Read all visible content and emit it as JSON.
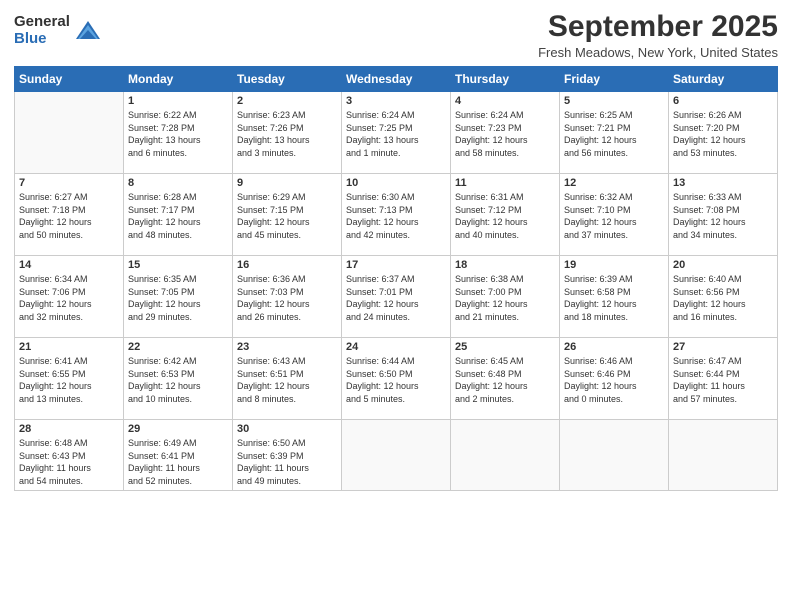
{
  "logo": {
    "general": "General",
    "blue": "Blue"
  },
  "header": {
    "month": "September 2025",
    "location": "Fresh Meadows, New York, United States"
  },
  "days_of_week": [
    "Sunday",
    "Monday",
    "Tuesday",
    "Wednesday",
    "Thursday",
    "Friday",
    "Saturday"
  ],
  "weeks": [
    [
      {
        "day": "",
        "info": ""
      },
      {
        "day": "1",
        "info": "Sunrise: 6:22 AM\nSunset: 7:28 PM\nDaylight: 13 hours\nand 6 minutes."
      },
      {
        "day": "2",
        "info": "Sunrise: 6:23 AM\nSunset: 7:26 PM\nDaylight: 13 hours\nand 3 minutes."
      },
      {
        "day": "3",
        "info": "Sunrise: 6:24 AM\nSunset: 7:25 PM\nDaylight: 13 hours\nand 1 minute."
      },
      {
        "day": "4",
        "info": "Sunrise: 6:24 AM\nSunset: 7:23 PM\nDaylight: 12 hours\nand 58 minutes."
      },
      {
        "day": "5",
        "info": "Sunrise: 6:25 AM\nSunset: 7:21 PM\nDaylight: 12 hours\nand 56 minutes."
      },
      {
        "day": "6",
        "info": "Sunrise: 6:26 AM\nSunset: 7:20 PM\nDaylight: 12 hours\nand 53 minutes."
      }
    ],
    [
      {
        "day": "7",
        "info": "Sunrise: 6:27 AM\nSunset: 7:18 PM\nDaylight: 12 hours\nand 50 minutes."
      },
      {
        "day": "8",
        "info": "Sunrise: 6:28 AM\nSunset: 7:17 PM\nDaylight: 12 hours\nand 48 minutes."
      },
      {
        "day": "9",
        "info": "Sunrise: 6:29 AM\nSunset: 7:15 PM\nDaylight: 12 hours\nand 45 minutes."
      },
      {
        "day": "10",
        "info": "Sunrise: 6:30 AM\nSunset: 7:13 PM\nDaylight: 12 hours\nand 42 minutes."
      },
      {
        "day": "11",
        "info": "Sunrise: 6:31 AM\nSunset: 7:12 PM\nDaylight: 12 hours\nand 40 minutes."
      },
      {
        "day": "12",
        "info": "Sunrise: 6:32 AM\nSunset: 7:10 PM\nDaylight: 12 hours\nand 37 minutes."
      },
      {
        "day": "13",
        "info": "Sunrise: 6:33 AM\nSunset: 7:08 PM\nDaylight: 12 hours\nand 34 minutes."
      }
    ],
    [
      {
        "day": "14",
        "info": "Sunrise: 6:34 AM\nSunset: 7:06 PM\nDaylight: 12 hours\nand 32 minutes."
      },
      {
        "day": "15",
        "info": "Sunrise: 6:35 AM\nSunset: 7:05 PM\nDaylight: 12 hours\nand 29 minutes."
      },
      {
        "day": "16",
        "info": "Sunrise: 6:36 AM\nSunset: 7:03 PM\nDaylight: 12 hours\nand 26 minutes."
      },
      {
        "day": "17",
        "info": "Sunrise: 6:37 AM\nSunset: 7:01 PM\nDaylight: 12 hours\nand 24 minutes."
      },
      {
        "day": "18",
        "info": "Sunrise: 6:38 AM\nSunset: 7:00 PM\nDaylight: 12 hours\nand 21 minutes."
      },
      {
        "day": "19",
        "info": "Sunrise: 6:39 AM\nSunset: 6:58 PM\nDaylight: 12 hours\nand 18 minutes."
      },
      {
        "day": "20",
        "info": "Sunrise: 6:40 AM\nSunset: 6:56 PM\nDaylight: 12 hours\nand 16 minutes."
      }
    ],
    [
      {
        "day": "21",
        "info": "Sunrise: 6:41 AM\nSunset: 6:55 PM\nDaylight: 12 hours\nand 13 minutes."
      },
      {
        "day": "22",
        "info": "Sunrise: 6:42 AM\nSunset: 6:53 PM\nDaylight: 12 hours\nand 10 minutes."
      },
      {
        "day": "23",
        "info": "Sunrise: 6:43 AM\nSunset: 6:51 PM\nDaylight: 12 hours\nand 8 minutes."
      },
      {
        "day": "24",
        "info": "Sunrise: 6:44 AM\nSunset: 6:50 PM\nDaylight: 12 hours\nand 5 minutes."
      },
      {
        "day": "25",
        "info": "Sunrise: 6:45 AM\nSunset: 6:48 PM\nDaylight: 12 hours\nand 2 minutes."
      },
      {
        "day": "26",
        "info": "Sunrise: 6:46 AM\nSunset: 6:46 PM\nDaylight: 12 hours\nand 0 minutes."
      },
      {
        "day": "27",
        "info": "Sunrise: 6:47 AM\nSunset: 6:44 PM\nDaylight: 11 hours\nand 57 minutes."
      }
    ],
    [
      {
        "day": "28",
        "info": "Sunrise: 6:48 AM\nSunset: 6:43 PM\nDaylight: 11 hours\nand 54 minutes."
      },
      {
        "day": "29",
        "info": "Sunrise: 6:49 AM\nSunset: 6:41 PM\nDaylight: 11 hours\nand 52 minutes."
      },
      {
        "day": "30",
        "info": "Sunrise: 6:50 AM\nSunset: 6:39 PM\nDaylight: 11 hours\nand 49 minutes."
      },
      {
        "day": "",
        "info": ""
      },
      {
        "day": "",
        "info": ""
      },
      {
        "day": "",
        "info": ""
      },
      {
        "day": "",
        "info": ""
      }
    ]
  ]
}
